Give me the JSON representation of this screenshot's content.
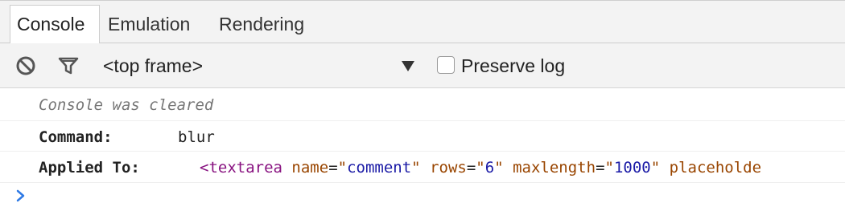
{
  "tabs": [
    {
      "label": "Console",
      "active": true
    },
    {
      "label": "Emulation",
      "active": false
    },
    {
      "label": "Rendering",
      "active": false
    }
  ],
  "toolbar": {
    "clear_icon": "clear-console-icon",
    "filter_icon": "filter-icon",
    "frame_selected": "<top frame>",
    "preserve_log_label": "Preserve log",
    "preserve_log_checked": false
  },
  "messages": {
    "cleared_text": "Console was cleared",
    "command_label": "Command:",
    "command_value": "blur",
    "applied_label": "Applied To:",
    "element": {
      "open": "<",
      "tag": "textarea",
      "attrs": [
        {
          "name": "name",
          "value": "comment"
        },
        {
          "name": "rows",
          "value": "6"
        },
        {
          "name": "maxlength",
          "value": "1000"
        },
        {
          "name": "placeholde",
          "value": ""
        }
      ]
    }
  },
  "prompt_icon": "chevron-right-icon",
  "colors": {
    "tag": "#881280",
    "attr_name": "#994500",
    "attr_value": "#1a1aa6",
    "prompt": "#2f7ae5"
  }
}
